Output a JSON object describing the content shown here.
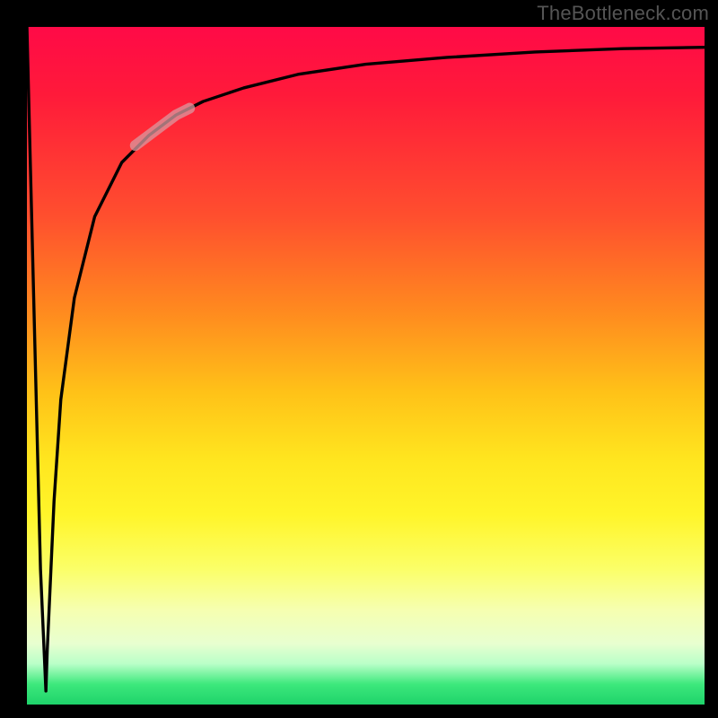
{
  "watermark": "TheBottleneck.com",
  "chart_data": {
    "type": "line",
    "title": "",
    "xlabel": "",
    "ylabel": "",
    "xlim": [
      0,
      100
    ],
    "ylim": [
      0,
      100
    ],
    "background_gradient": {
      "top": "#ff0a47",
      "mid": "#ffe61f",
      "bottom": "#1ed36a"
    },
    "series": [
      {
        "name": "main-curve",
        "color": "#000000",
        "x": [
          0,
          1,
          2,
          2.8,
          3,
          4,
          5,
          7,
          10,
          14,
          18,
          22,
          26,
          32,
          40,
          50,
          62,
          75,
          88,
          100
        ],
        "values": [
          100,
          60,
          20,
          2,
          8,
          30,
          45,
          60,
          72,
          80,
          84,
          87,
          89,
          91,
          93,
          94.5,
          95.5,
          96.3,
          96.8,
          97
        ]
      },
      {
        "name": "highlight-segment",
        "color": "#d99aa0",
        "x": [
          16,
          18,
          20,
          22,
          24
        ],
        "values": [
          82.5,
          84,
          85.5,
          87,
          88
        ]
      }
    ]
  }
}
